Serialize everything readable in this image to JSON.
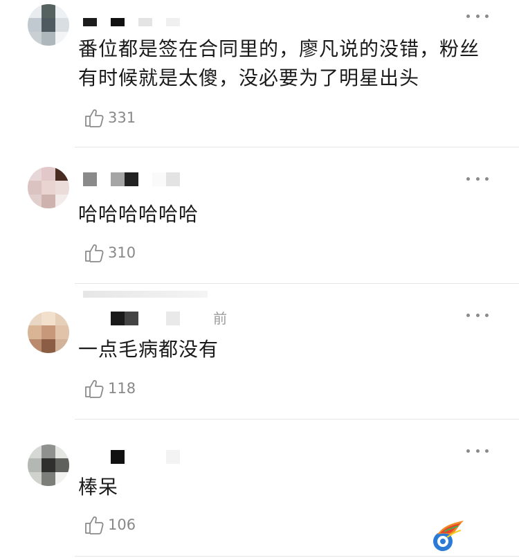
{
  "comments": [
    {
      "text": "番位都是签在合同里的，廖凡说的没错，粉丝有时候就是太傻，没必要为了明星出头",
      "likes": "331"
    },
    {
      "text": "哈哈哈哈哈哈",
      "likes": "310"
    },
    {
      "time_suffix": "前",
      "text": "一点毛病都没有",
      "likes": "118"
    },
    {
      "text": "棒呆",
      "likes": "106"
    }
  ]
}
